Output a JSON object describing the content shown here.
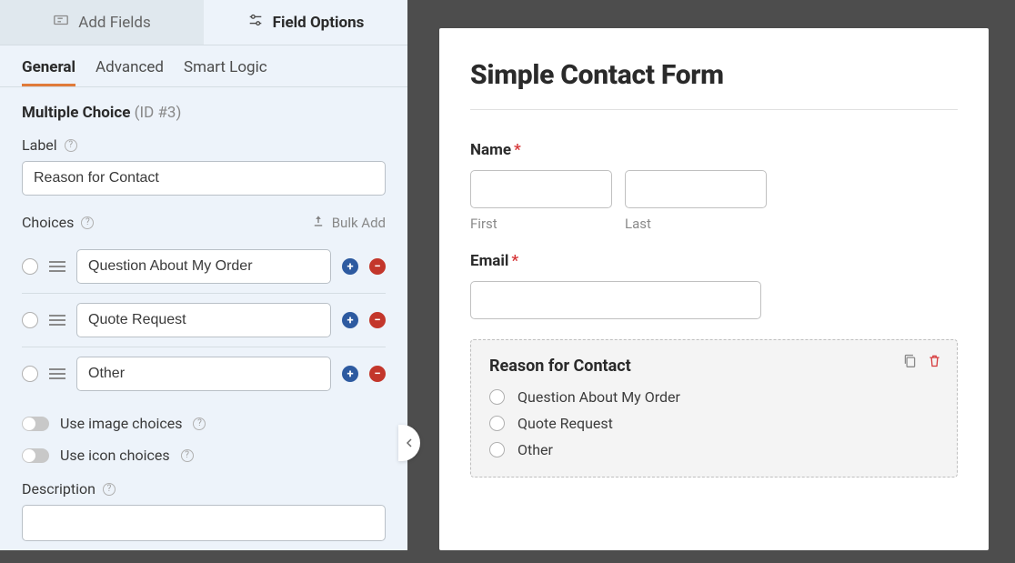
{
  "topTabs": {
    "addFields": "Add Fields",
    "fieldOptions": "Field Options"
  },
  "subTabs": {
    "general": "General",
    "advanced": "Advanced",
    "smartLogic": "Smart Logic"
  },
  "panel": {
    "fieldTitle": "Multiple Choice",
    "idPart": "(ID #3)",
    "labelCaption": "Label",
    "labelValue": "Reason for Contact",
    "choicesCaption": "Choices",
    "bulkAdd": "Bulk Add",
    "choices": [
      {
        "value": "Question About My Order"
      },
      {
        "value": "Quote Request"
      },
      {
        "value": "Other"
      }
    ],
    "imageChoicesLabel": "Use image choices",
    "iconChoicesLabel": "Use icon choices",
    "descriptionCaption": "Description"
  },
  "preview": {
    "title": "Simple Contact Form",
    "nameLabel": "Name",
    "firstLabel": "First",
    "lastLabel": "Last",
    "emailLabel": "Email",
    "reason": {
      "title": "Reason for Contact",
      "options": [
        "Question About My Order",
        "Quote Request",
        "Other"
      ]
    }
  }
}
